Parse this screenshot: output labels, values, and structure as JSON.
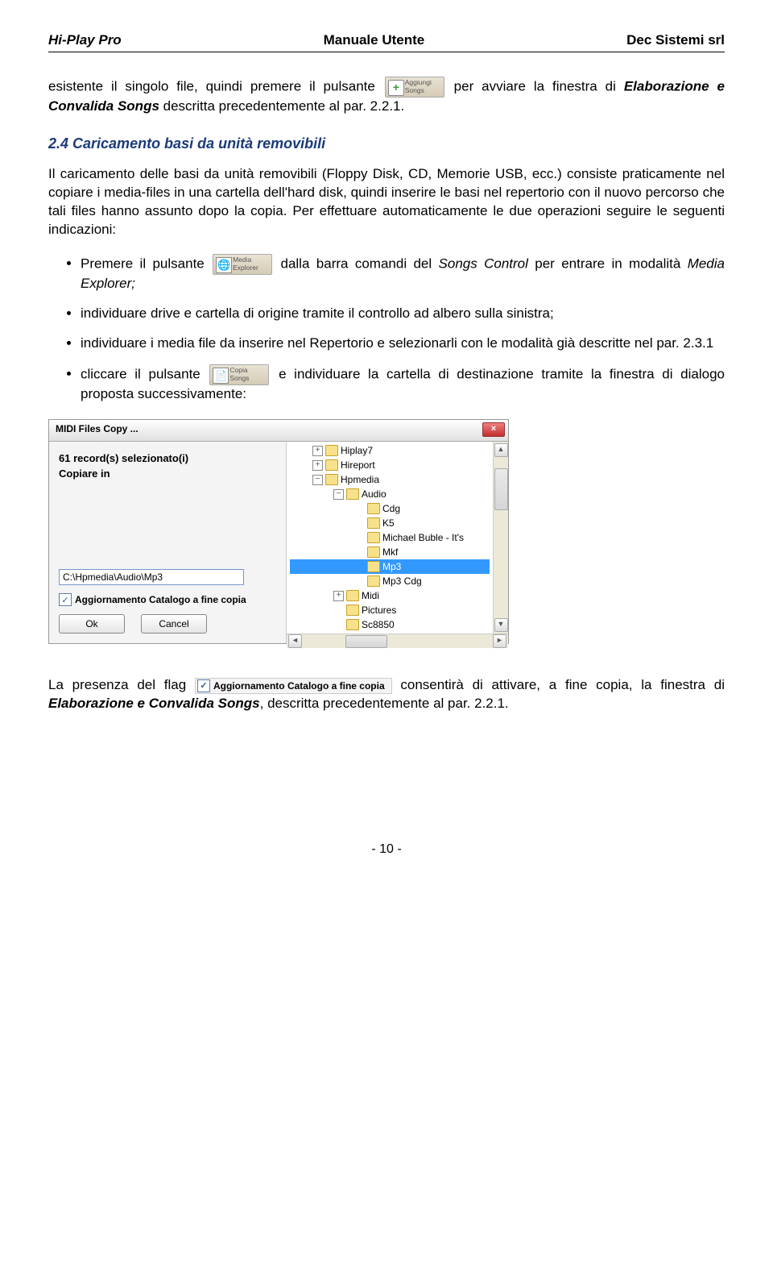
{
  "header": {
    "left": "Hi-Play Pro",
    "center": "Manuale Utente",
    "right": "Dec Sistemi srl"
  },
  "p1a": "esistente il singolo file, quindi premere il pulsante ",
  "btn_aggiungi1": "Aggiungi",
  "btn_aggiungi2": "Songs",
  "p1b": " per avviare la finestra di ",
  "p1c": "Elaborazione e Convalida Songs",
  "p1d": " descritta precedentemente al par. 2.2.1.",
  "section": "2.4 Caricamento basi da unità removibili",
  "p2": "Il caricamento delle basi da unità removibili (Floppy Disk, CD, Memorie USB, ecc.) consiste praticamente nel copiare i media-files in una cartella dell'hard disk, quindi inserire le basi nel repertorio con il nuovo percorso che tali files hanno assunto dopo la copia. Per effettuare automaticamente le due operazioni  seguire le seguenti indicazioni:",
  "li1a": "Premere il pulsante ",
  "btn_media1": "Media",
  "btn_media2": "Explorer",
  "li1b": " dalla barra comandi del ",
  "li1c": "Songs Control",
  "li1d": " per entrare in modalità ",
  "li1e": "Media Explorer;",
  "li2": "individuare drive e cartella di origine tramite il controllo ad albero sulla sinistra;",
  "li3": "individuare i media file da inserire nel Repertorio e selezionarli con le modalità già descritte nel par. 2.3.1",
  "li4a": "cliccare il pulsante ",
  "btn_copia1": "Copia",
  "btn_copia2": "Songs",
  "li4b": " e individuare la cartella di destinazione tramite la finestra di dialogo proposta successivamente:",
  "dialog": {
    "title": "MIDI Files Copy ...",
    "summary1": "61  record(s) selezionato(i)",
    "summary2": "Copiare in",
    "path": "C:\\Hpmedia\\Audio\\Mp3",
    "chk_label": "Aggiornamento Catalogo a fine copia",
    "ok": "Ok",
    "cancel": "Cancel",
    "tree": [
      {
        "indent": 2,
        "tog": "+",
        "label": "Hiplay7"
      },
      {
        "indent": 2,
        "tog": "+",
        "label": "Hireport"
      },
      {
        "indent": 2,
        "tog": "−",
        "label": "Hpmedia"
      },
      {
        "indent": 3,
        "tog": "−",
        "label": "Audio"
      },
      {
        "indent": 4,
        "tog": "",
        "label": "Cdg"
      },
      {
        "indent": 4,
        "tog": "",
        "label": "K5"
      },
      {
        "indent": 4,
        "tog": "",
        "label": "Michael Buble - It's "
      },
      {
        "indent": 4,
        "tog": "",
        "label": "Mkf"
      },
      {
        "indent": 4,
        "tog": "",
        "label": "Mp3",
        "sel": true
      },
      {
        "indent": 4,
        "tog": "",
        "label": "Mp3 Cdg"
      },
      {
        "indent": 3,
        "tog": "+",
        "label": "Midi"
      },
      {
        "indent": 3,
        "tog": "",
        "label": "Pictures"
      },
      {
        "indent": 3,
        "tog": "",
        "label": "Sc8850"
      }
    ]
  },
  "p3a": "La presenza del flag ",
  "inline_chk": "Aggiornamento Catalogo a fine copia",
  "p3b": " consentirà di attivare, a fine copia, la finestra di ",
  "p3c": "Elaborazione e Convalida Songs",
  "p3d": ", descritta precedentemente al par. 2.2.1.",
  "footer": "- 10 -"
}
